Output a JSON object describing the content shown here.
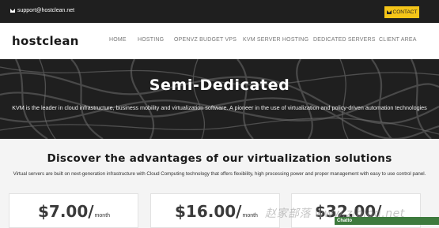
{
  "topbar": {
    "email": "support@hostclean.net",
    "email_icon": "envelope-icon",
    "contact_label": "CONTACT"
  },
  "logo": {
    "text": "hostclean"
  },
  "nav": {
    "items": [
      {
        "label": "HOME"
      },
      {
        "label": "HOSTING"
      },
      {
        "label": "OPENVZ BUDGET VPS"
      },
      {
        "label": "KVM SERVER HOSTING"
      },
      {
        "label": "DEDICATED SERVERS"
      },
      {
        "label": "CLIENT AREA"
      }
    ]
  },
  "hero": {
    "title": "Semi-Dedicated",
    "text": "KVM is the leader in cloud infrastructure, business mobility and virtualization software. A pioneer in the use of virtualization and policy-driven automation technologies"
  },
  "advantages": {
    "title": "Discover the advantages of our virtualization solutions",
    "text": "Virtual servers are built on next-generation infrastructure with Cloud Computing technology that offers flexibility, high processing power and proper management with easy to use control panel."
  },
  "pricing": [
    {
      "amount": "$7.00/",
      "period": "month"
    },
    {
      "amount": "$16.00/",
      "period": "month"
    },
    {
      "amount": "$32.00/",
      "period": ""
    }
  ],
  "watermark": "赵家部落 www.zjblog.net",
  "chat": {
    "label": "Chatto"
  },
  "colors": {
    "accent": "#f5c518",
    "topbar": "#1f1f1f",
    "chat": "#3d7a3d"
  }
}
